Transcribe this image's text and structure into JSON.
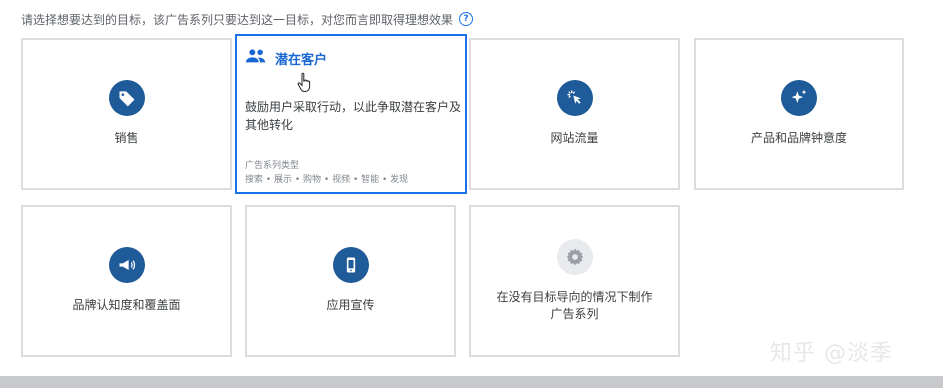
{
  "header": {
    "prompt": "请选择想要达到的目标，该广告系列只要达到这一目标，对您而言即取得理想效果",
    "help_icon": "help-icon"
  },
  "cards": [
    {
      "id": "sales",
      "label": "销售",
      "icon": "tag-icon"
    },
    {
      "id": "leads",
      "label": "潜在客户",
      "icon": "people-icon",
      "selected": true,
      "description": "鼓励用户采取行动，以此争取潜在客户及其他转化",
      "meta_label": "广告系列类型",
      "meta_value": "搜索 • 展示 • 购物 • 视频 • 智能 • 发现"
    },
    {
      "id": "traffic",
      "label": "网站流量",
      "icon": "cursor-click-icon"
    },
    {
      "id": "consideration",
      "label": "产品和品牌钟意度",
      "icon": "sparkle-icon"
    },
    {
      "id": "awareness",
      "label": "品牌认知度和覆盖面",
      "icon": "megaphone-icon"
    },
    {
      "id": "app",
      "label": "应用宣传",
      "icon": "phone-icon"
    },
    {
      "id": "no_goal",
      "label": "在没有目标导向的情况下制作广告系列",
      "icon": "gear-icon"
    }
  ],
  "watermark": "知乎 @淡季",
  "colors": {
    "accent": "#1a73e8",
    "icon_bg": "#1f5a99",
    "border": "#dadce0"
  }
}
